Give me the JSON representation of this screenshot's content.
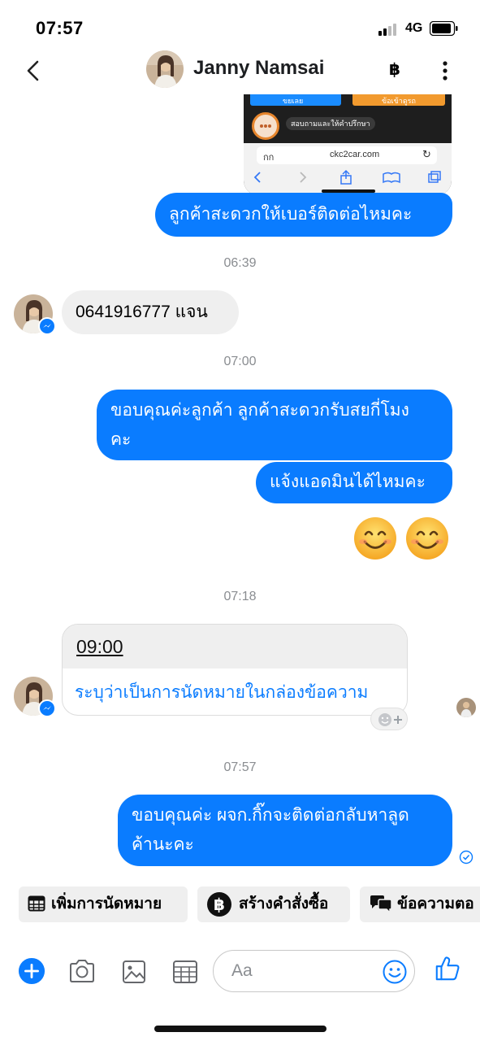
{
  "status_bar": {
    "time": "07:57",
    "network": "4G",
    "icons": [
      "signal-icon",
      "battery-icon"
    ]
  },
  "header": {
    "contact_name": "Janny Namsai",
    "icons": [
      "back-chevron-icon",
      "baht-icon",
      "more-vertical-icon"
    ],
    "baht_symbol": "฿"
  },
  "messages": {
    "preview": {
      "left_button": "ขยเลย",
      "right_button": "ข้อเข้าดูรถ",
      "banner": "สอบถามและให้คำปรึกษา",
      "url": "ckc2car.com",
      "url_prefix": "กก"
    },
    "out_1": "ลูกค้าสะดวกให้เบอร์ติดต่อไหมคะ",
    "time_1": "06:39",
    "in_1": "0641916777 แจน",
    "time_2": "07:00",
    "out_2_line1": "ขอบคุณค่ะลูกค้า ลูกค้าสะดวกรับสยกี่โมง",
    "out_2_line2": "คะ",
    "out_3": "แจ้งแอดมินได้ไหมคะ",
    "emojis": [
      "😊",
      "😊"
    ],
    "time_3": "07:18",
    "appointment_time": "09:00",
    "appointment_link": "ระบุว่าเป็นการนัดหมายในกล่องข้อความ",
    "time_4": "07:57",
    "out_4_line1": "ขอบคุณค่ะ ผจก.กิ๊กจะติดต่อกลับหาลูด",
    "out_4_line2": "ค้านะคะ"
  },
  "quick_actions": [
    {
      "label": "เพิ่มการนัดหมาย",
      "icon": "calendar-icon"
    },
    {
      "label": "สร้างคำสั่งซื้อ",
      "icon": "baht-circle-icon"
    },
    {
      "label": "ข้อความตอ",
      "icon": "chat-bubbles-icon"
    }
  ],
  "composer": {
    "placeholder": "Aa",
    "icons": [
      "plus-icon",
      "camera-icon",
      "image-icon",
      "calendar-icon",
      "emoji-icon",
      "like-icon"
    ]
  },
  "colors": {
    "accent": "#0a7cff",
    "incoming_bubble": "#efefef",
    "timestamp": "#8a8d91"
  }
}
